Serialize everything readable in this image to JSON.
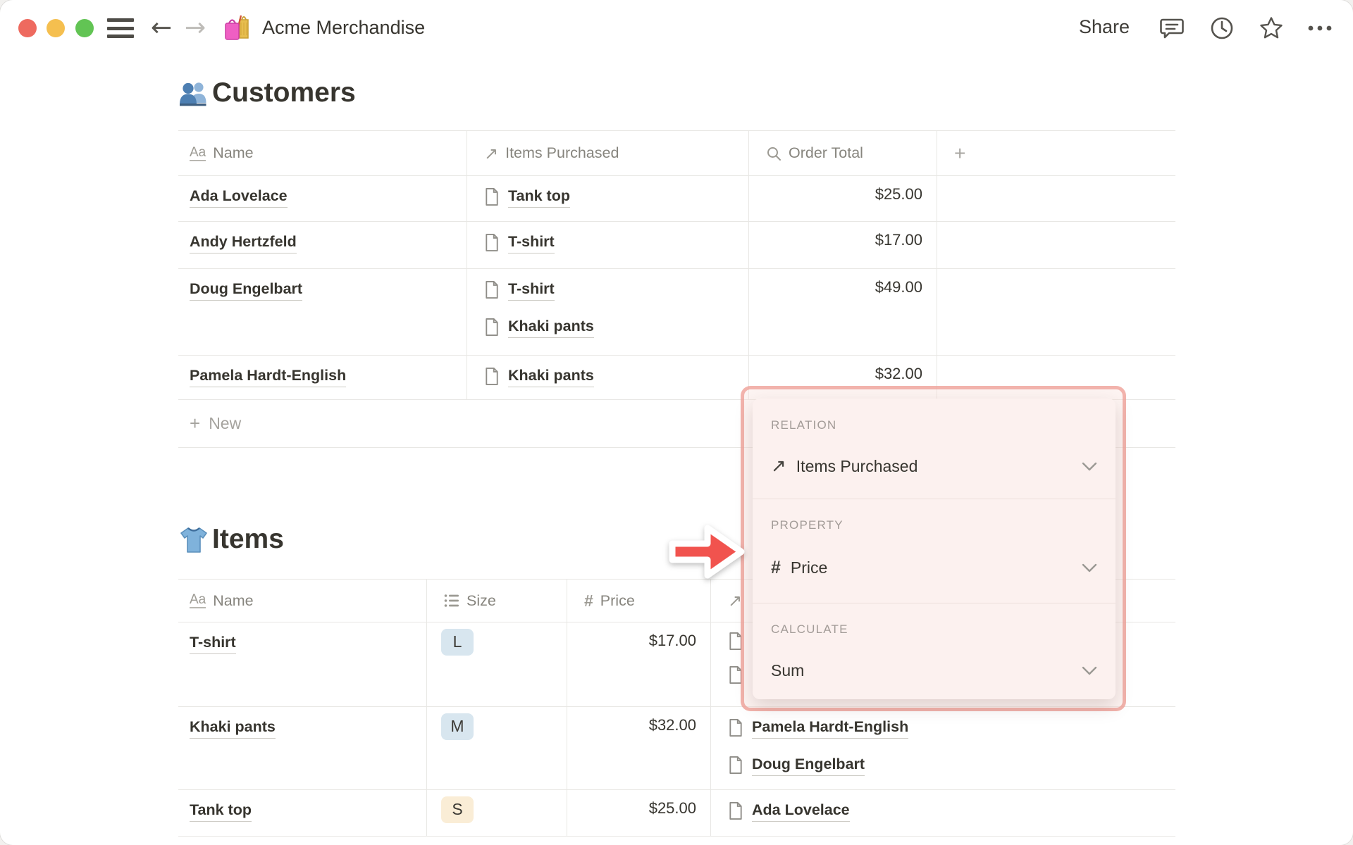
{
  "window": {
    "title": "Acme Merchandise",
    "share_label": "Share",
    "nav_back": "←",
    "nav_forward": "→"
  },
  "customers": {
    "section_title": "Customers",
    "columns": [
      {
        "label": "Name",
        "icon": "text-property-icon",
        "icon_glyph": "Aa"
      },
      {
        "label": "Items Purchased",
        "icon": "relation-property-icon",
        "icon_glyph": "↗"
      },
      {
        "label": "Order Total",
        "icon": "rollup-property-icon"
      },
      {
        "label": "+",
        "icon": "add-column-icon"
      }
    ],
    "rows": [
      {
        "name": "Ada Lovelace",
        "items": [
          "Tank top"
        ],
        "total": "$25.00"
      },
      {
        "name": "Andy Hertzfeld",
        "items": [
          "T-shirt"
        ],
        "total": "$17.00"
      },
      {
        "name": "Doug Engelbart",
        "items": [
          "T-shirt",
          "Khaki pants"
        ],
        "total": "$49.00"
      },
      {
        "name": "Pamela Hardt-English",
        "items": [
          "Khaki pants"
        ],
        "total": "$32.00"
      }
    ],
    "new_row": {
      "plus": "+",
      "label": "New"
    }
  },
  "items": {
    "section_title": "Items",
    "columns": [
      {
        "label": "Name",
        "icon": "text-property-icon",
        "icon_glyph": "Aa"
      },
      {
        "label": "Size",
        "icon": "select-property-icon"
      },
      {
        "label": "Price",
        "icon": "number-property-icon",
        "icon_glyph": "#"
      },
      {
        "label": "",
        "icon": "relation-property-icon",
        "icon_glyph": "↗"
      }
    ],
    "rows": [
      {
        "name": "T-shirt",
        "size": "L",
        "size_color": "blue",
        "price": "$17.00",
        "customers": [
          "",
          ""
        ]
      },
      {
        "name": "Khaki pants",
        "size": "M",
        "size_color": "blue",
        "price": "$32.00",
        "customers": [
          "Pamela Hardt-English",
          "Doug Engelbart"
        ]
      },
      {
        "name": "Tank top",
        "size": "S",
        "size_color": "yellow",
        "price": "$25.00",
        "customers": [
          "Ada Lovelace"
        ]
      }
    ]
  },
  "popup": {
    "relation_label": "RELATION",
    "relation_value": "Items Purchased",
    "relation_icon_glyph": "↗",
    "property_label": "PROPERTY",
    "property_value": "Price",
    "property_icon_glyph": "#",
    "calculate_label": "CALCULATE",
    "calculate_value": "Sum"
  },
  "colors": {
    "text_primary": "#37352F",
    "text_gray": "#87857E",
    "table_border": "#E8E7E4",
    "badge_blue": "#D8E6EF",
    "badge_yellow": "#FAEDD6",
    "popup_background": "#FCF1EF",
    "popup_border": "#EE9A92",
    "annotation_red": "#F1534E",
    "traffic_red": "#EE6A5F",
    "traffic_yellow": "#F5BF4F",
    "traffic_green": "#62C454"
  }
}
